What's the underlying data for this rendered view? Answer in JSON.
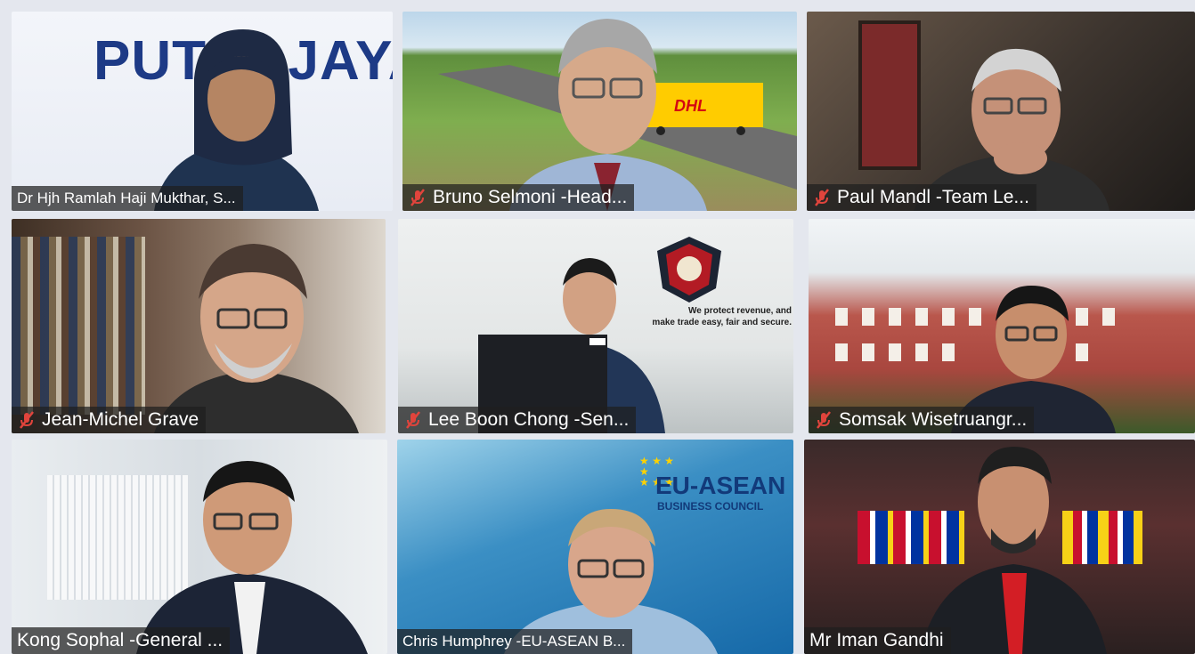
{
  "participants": [
    {
      "name_label": "Dr Hjh Ramlah Haji Mukthar, S...",
      "muted": false
    },
    {
      "name_label": "Bruno Selmoni -Head...",
      "muted": true
    },
    {
      "name_label": "Paul Mandl -Team Le...",
      "muted": true
    },
    {
      "name_label": "Jean-Michel Grave",
      "muted": true
    },
    {
      "name_label": "Lee Boon Chong -Sen...",
      "muted": true
    },
    {
      "name_label": "Somsak Wisetruangr...",
      "muted": true
    },
    {
      "name_label": "Kong Sophal -General ...",
      "muted": false
    },
    {
      "name_label": "Chris Humphrey -EU-ASEAN B...",
      "muted": false
    },
    {
      "name_label": "Mr Iman Gandhi",
      "muted": false
    }
  ],
  "backgrounds": {
    "putrajaya_sign": "PUTRAJAYA",
    "dhl_truck": "DHL",
    "customs_motto_line1": "We protect revenue, and",
    "customs_motto_line2": "make trade easy, fair and secure.",
    "euasean_line1": "EU-ASEAN",
    "euasean_line2": "BUSINESS COUNCIL"
  },
  "colors": {
    "mic_muted": "#e0443c",
    "label_bg": "#1e1e1e",
    "dhl_yellow": "#ffcc00",
    "dhl_red": "#d40511"
  }
}
